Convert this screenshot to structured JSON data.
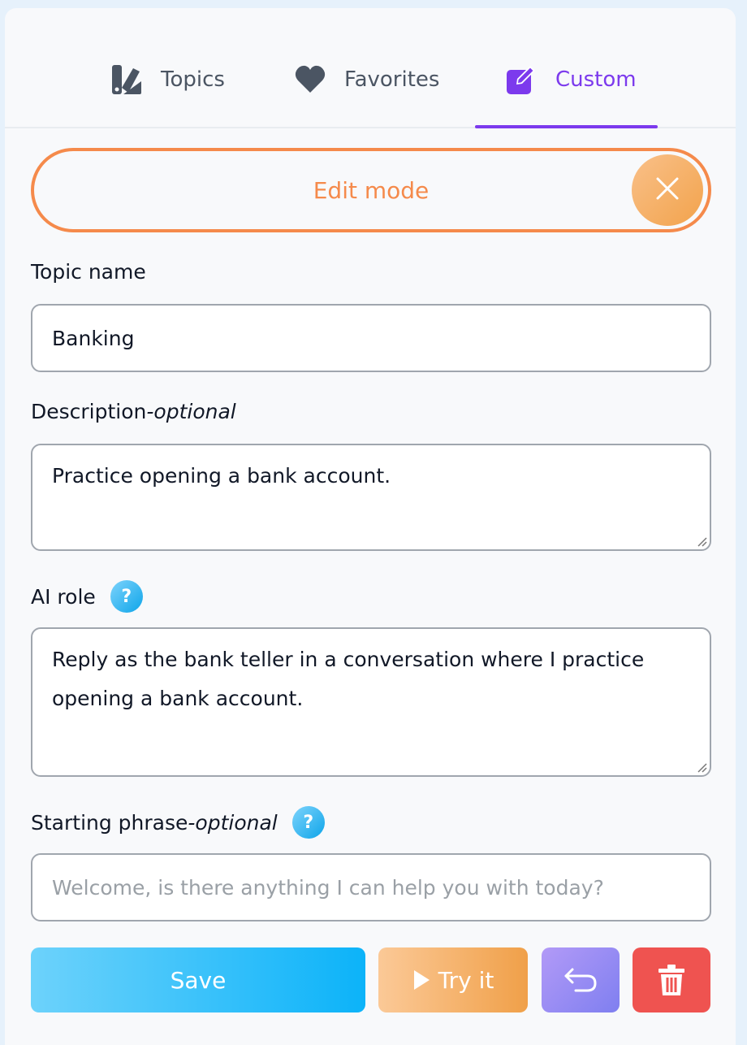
{
  "tabs": [
    {
      "label": "Topics",
      "icon": "topics-swatch-icon",
      "active": false
    },
    {
      "label": "Favorites",
      "icon": "heart-icon",
      "active": false
    },
    {
      "label": "Custom",
      "icon": "edit-square-icon",
      "active": true
    }
  ],
  "edit_mode": {
    "label": "Edit mode",
    "close_icon": "close-icon"
  },
  "form": {
    "topic_name": {
      "label": "Topic name",
      "value": "Banking"
    },
    "description": {
      "label": "Description ",
      "optional": "-optional",
      "value": "Practice opening a bank account."
    },
    "ai_role": {
      "label": "AI role",
      "help": "?",
      "value_line1": "Reply as the bank teller in a conversation where I practice",
      "value_line2": "opening a bank account."
    },
    "starting_phrase": {
      "label": "Starting phrase ",
      "optional": "-optional",
      "help": "?",
      "placeholder": "Welcome, is there anything I can help you with today?"
    }
  },
  "actions": {
    "save": "Save",
    "try": "Try it",
    "undo_icon": "undo-arrow-icon",
    "delete_icon": "trash-icon"
  },
  "colors": {
    "accent_purple": "#7c3aed",
    "edit_orange": "#f58a4b",
    "save_blue": "#0cb3f9",
    "delete_red": "#ef5350"
  }
}
